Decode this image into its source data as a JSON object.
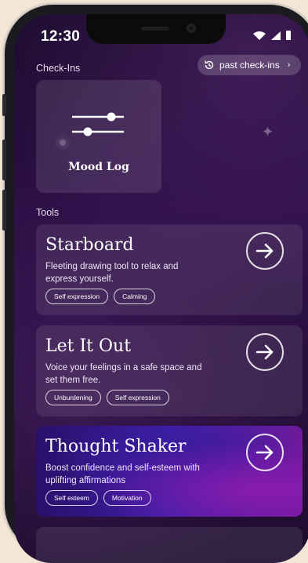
{
  "status_bar": {
    "time": "12:30",
    "icons": [
      "wifi-icon",
      "cellular-icon",
      "battery-icon"
    ]
  },
  "checkins": {
    "label": "Check-Ins",
    "past_button_label": "past check-ins",
    "past_button_icon": "history-icon",
    "mood_log": {
      "title": "Mood Log",
      "icon": "sliders-icon"
    }
  },
  "tools": {
    "label": "Tools",
    "items": [
      {
        "title": "Starboard",
        "description": "Fleeting drawing tool to relax and express yourself.",
        "tags": [
          "Self expression",
          "Calming"
        ]
      },
      {
        "title": "Let It Out",
        "description": "Voice your feelings in a safe space and set them free.",
        "tags": [
          "Unburdening",
          "Self expression"
        ]
      },
      {
        "title": "Thought Shaker",
        "description": "Boost confidence and self-esteem with uplifting affirmations",
        "tags": [
          "Self esteem",
          "Motivation"
        ]
      }
    ]
  },
  "colors": {
    "background": "#2c0f45",
    "featured_gradient_start": "#2a0f6a",
    "featured_gradient_end": "#6d1a9a",
    "frame": "#f4e6d6"
  }
}
